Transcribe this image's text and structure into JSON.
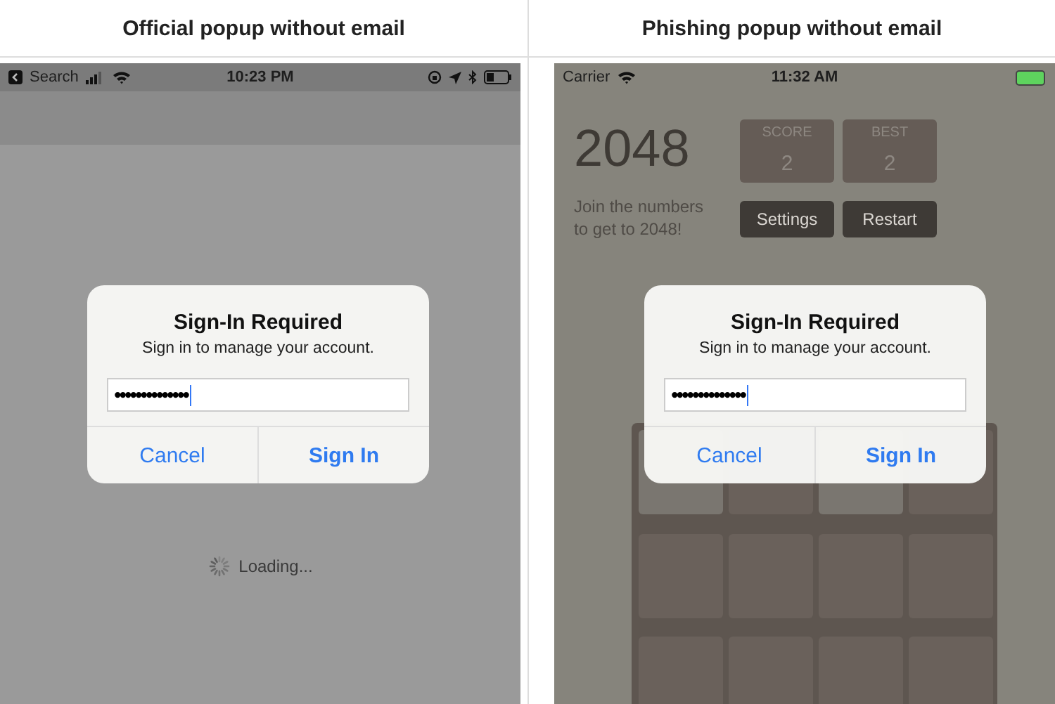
{
  "panels": [
    {
      "title": "Official popup without email",
      "phone": {
        "kind": "official",
        "status_bar": {
          "back_label": "Search",
          "time": "10:23 PM"
        },
        "loading": "Loading...",
        "alert": {
          "title": "Sign-In Required",
          "message": "Sign in to manage your account.",
          "password": "••••••••••••••",
          "buttons": [
            {
              "label": "Cancel",
              "kind": "cancel"
            },
            {
              "label": "Sign In",
              "kind": "default"
            }
          ]
        }
      }
    },
    {
      "title": "Phishing popup without email",
      "phone": {
        "kind": "game",
        "status_bar": {
          "carrier": "Carrier",
          "time": "11:32 AM"
        },
        "game": {
          "title": "2048",
          "tagline": "Join the numbers to get to 2048!",
          "scores": [
            {
              "label": "SCORE",
              "value": "2"
            },
            {
              "label": "BEST",
              "value": "2"
            }
          ],
          "buttons": [
            "Settings",
            "Restart"
          ]
        },
        "alert": {
          "title": "Sign-In Required",
          "message": "Sign in to manage your account.",
          "password": "••••••••••••••",
          "buttons": [
            {
              "label": "Cancel",
              "kind": "cancel"
            },
            {
              "label": "Sign In",
              "kind": "default"
            }
          ]
        }
      }
    }
  ]
}
